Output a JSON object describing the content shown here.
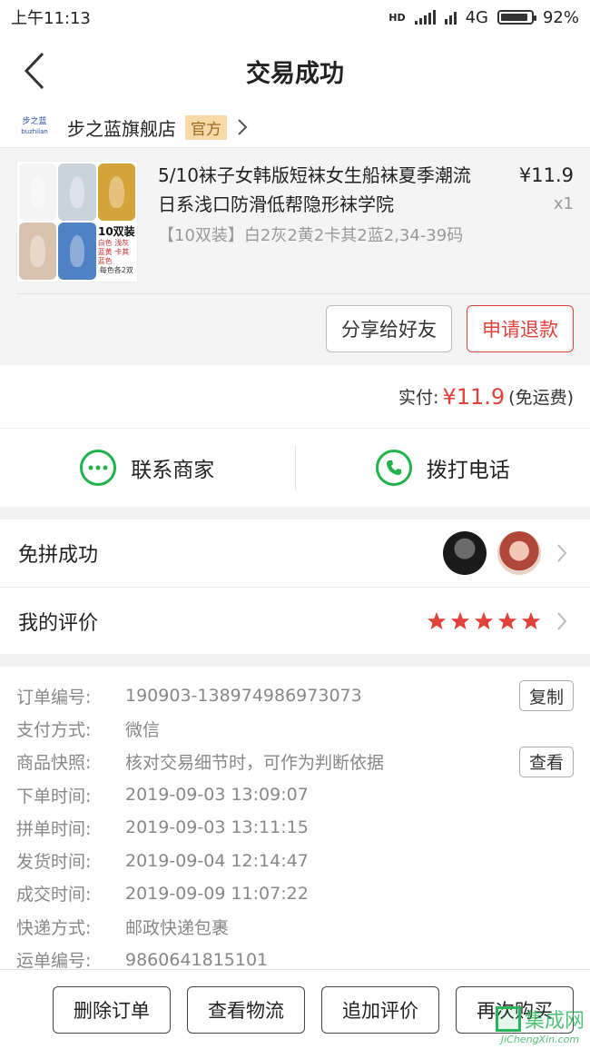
{
  "status_bar": {
    "time": "上午11:13",
    "network": "4G",
    "network_hd": "HD",
    "battery": "92%",
    "battery_level": 0.92
  },
  "header": {
    "title": "交易成功"
  },
  "shop": {
    "logo_text": "步之蓝",
    "logo_sub": "buzhilan",
    "name": "步之蓝旗舰店",
    "badge": "官方"
  },
  "product": {
    "title": "5/10袜子女韩版短袜女生船袜夏季潮流日系浅口防滑低帮隐形袜学院",
    "spec": "【10双装】白2灰2黄2卡其2蓝2,34-39码",
    "price": "¥11.9",
    "quantity": "x1",
    "thumb_label": "10双装",
    "thumb_colors_text": "白色 浅灰 蓝黄 卡其 蓝色",
    "thumb_note": "每色各2双",
    "sock_colors": [
      "#f4f4f4",
      "#c9d3dc",
      "#d4a43a",
      "#d9c3ae",
      "#4f82c4"
    ],
    "buttons": {
      "share": "分享给好友",
      "refund": "申请退款"
    }
  },
  "payment": {
    "label": "实付:",
    "amount": "¥11.9",
    "note": "(免运费)"
  },
  "contact": {
    "merchant": "联系商家",
    "phone": "拨打电话"
  },
  "group": {
    "label": "免拼成功"
  },
  "review": {
    "label": "我的评价",
    "rating": 5
  },
  "details": [
    {
      "label": "订单编号:",
      "value": "190903-138974986973073",
      "action": "复制"
    },
    {
      "label": "支付方式:",
      "value": "微信"
    },
    {
      "label": "商品快照:",
      "value": "核对交易细节时，可作为判断依据",
      "action": "查看"
    },
    {
      "label": "下单时间:",
      "value": "2019-09-03 13:09:07"
    },
    {
      "label": "拼单时间:",
      "value": "2019-09-03 13:11:15"
    },
    {
      "label": "发货时间:",
      "value": "2019-09-04 12:14:47"
    },
    {
      "label": "成交时间:",
      "value": "2019-09-09 11:07:22"
    },
    {
      "label": "快递方式:",
      "value": "邮政快递包裹"
    },
    {
      "label": "运单编号:",
      "value": "9860641815101"
    }
  ],
  "bottom_actions": [
    "删除订单",
    "查看物流",
    "追加评价",
    "再次购买"
  ],
  "watermark": {
    "text": "集成网",
    "url": "JiChengXin.com"
  },
  "colors": {
    "accent_red": "#e0413a",
    "green": "#20b24b",
    "official_bg": "#f7d9a8"
  }
}
